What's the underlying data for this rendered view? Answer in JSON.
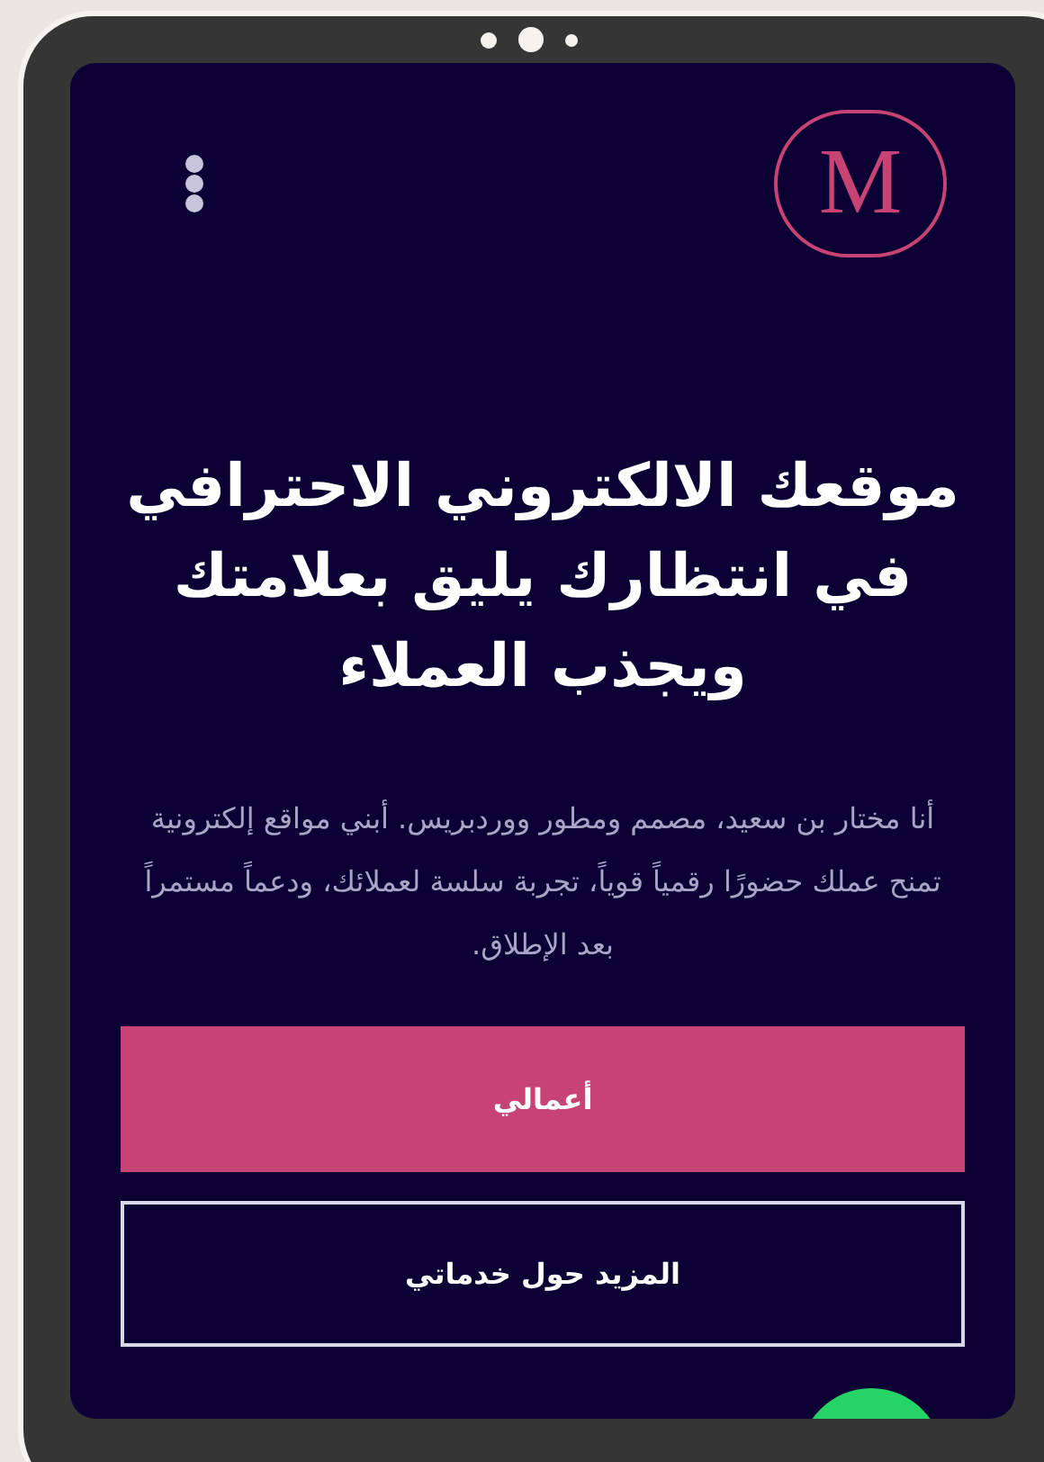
{
  "logo": {
    "letter": "M"
  },
  "hero": {
    "title_lines": [
      "موقعك الالكتروني الاحترافي",
      "في انتظارك يليق بعلامتك",
      "ويجذب العملاء"
    ],
    "description": "أنا مختار بن سعيد، مصمم ومطور ووردبريس. أبني مواقع إلكترونية تمنح عملك حضورًا رقمياً قوياً، تجربة سلسة لعملائك، ودعماً مستمراً بعد الإطلاق."
  },
  "buttons": [
    {
      "label": "أعمالي",
      "kind": "primary"
    },
    {
      "label": "المزيد حول خدماتي",
      "kind": "outline"
    }
  ]
}
